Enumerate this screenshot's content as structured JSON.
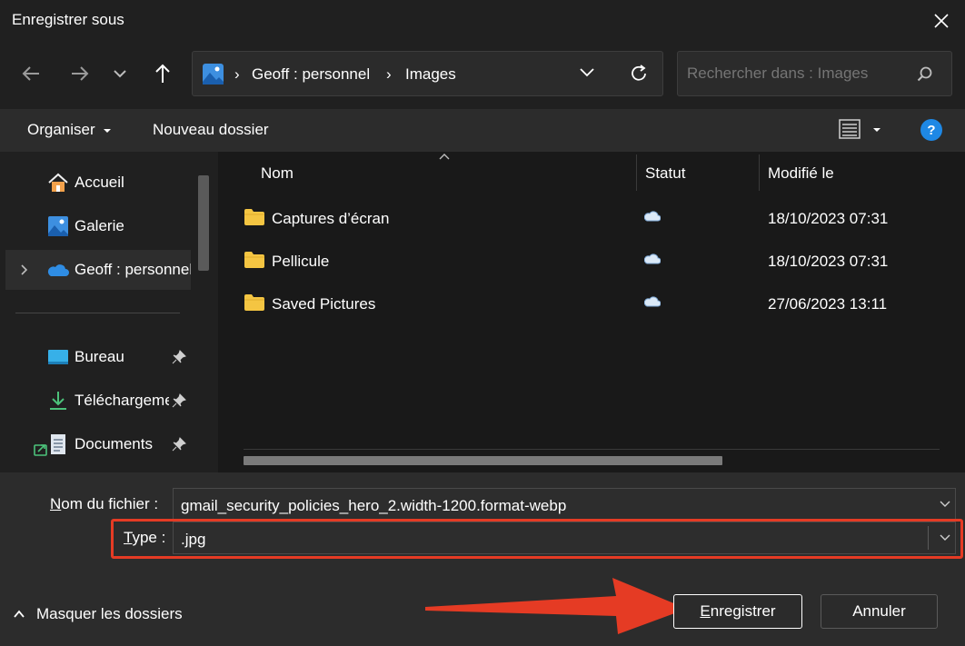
{
  "window": {
    "title": "Enregistrer sous"
  },
  "address": {
    "crumbs": [
      "Geoff : personnel",
      "Images"
    ],
    "separator": "›"
  },
  "search": {
    "placeholder": "Rechercher dans : Images"
  },
  "toolbar": {
    "organize_label": "Organiser",
    "new_folder_label": "Nouveau dossier"
  },
  "sidebar": {
    "items": [
      {
        "label": "Accueil",
        "icon": "home-icon"
      },
      {
        "label": "Galerie",
        "icon": "gallery-icon"
      },
      {
        "label": "Geoff : personnel",
        "icon": "onedrive-icon"
      },
      {
        "label": "Bureau",
        "icon": "desktop-icon"
      },
      {
        "label": "Téléchargements",
        "icon": "download-icon"
      },
      {
        "label": "Documents",
        "icon": "documents-icon"
      }
    ]
  },
  "columns": {
    "name": "Nom",
    "status": "Statut",
    "modified": "Modifié le"
  },
  "files": [
    {
      "name": "Captures d’écran",
      "date": "18/10/2023 07:31"
    },
    {
      "name": "Pellicule",
      "date": "18/10/2023 07:31"
    },
    {
      "name": "Saved Pictures",
      "date": "27/06/2023 13:11"
    }
  ],
  "form": {
    "filename_label_underlined": "N",
    "filename_label_rest": "om du fichier :",
    "filename_value": "gmail_security_policies_hero_2.width-1200.format-webp",
    "type_label_underlined": "T",
    "type_label_rest": "ype :",
    "type_value": ".jpg"
  },
  "footer": {
    "hide_folders_label": "Masquer les dossiers",
    "save_underlined": "E",
    "save_rest": "nregistrer",
    "cancel_label": "Annuler"
  },
  "colors": {
    "accent": "#4aa3e8",
    "annotation": "#e53b24",
    "folder": "#f4c542"
  }
}
